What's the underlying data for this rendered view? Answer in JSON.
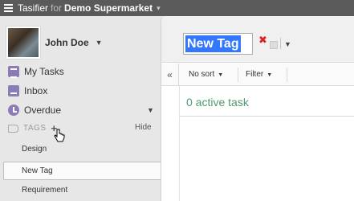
{
  "topbar": {
    "app_name": "Tasifier",
    "for_word": "for",
    "org_name": "Demo Supermarket",
    "caret": "▾"
  },
  "sidebar": {
    "user_name": "John Doe",
    "nav": [
      {
        "label": "My Tasks",
        "icon": "tasks-icon"
      },
      {
        "label": "Inbox",
        "icon": "inbox-icon"
      },
      {
        "label": "Overdue",
        "icon": "overdue-icon"
      }
    ],
    "tags_label": "TAGS",
    "add_tag": "+",
    "hide_label": "Hide",
    "tags": [
      "Design",
      "New Tag",
      "Requirement"
    ],
    "selected_tag_index": 1
  },
  "main": {
    "tag_title": "New Tag",
    "sort_label": "No sort",
    "filter_label": "Filter",
    "collapse_glyph": "«",
    "active_count_text": "0 active task"
  },
  "colors": {
    "topbar": "#5a5a5a",
    "selection": "#3377ff",
    "close": "#dd2222",
    "active_text": "#4f9a6e",
    "nav_icon": "#8c7cb5"
  }
}
